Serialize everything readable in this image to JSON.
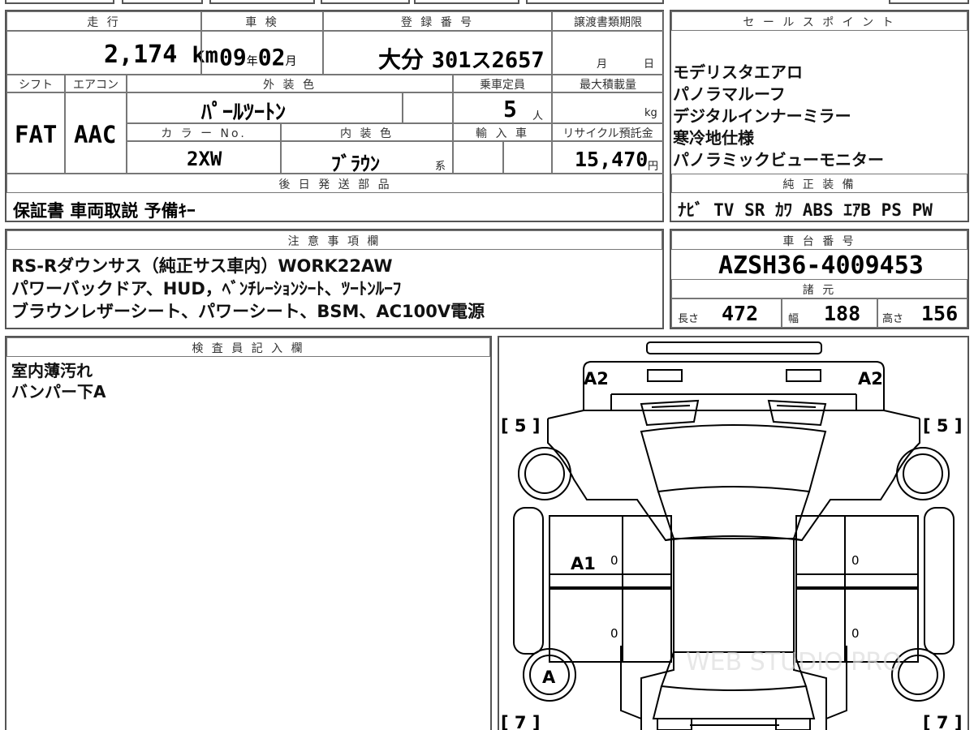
{
  "vehicle": {
    "mileage_label": "走 行",
    "mileage_value": "2,174",
    "mileage_unit": "km",
    "shaken_label": "車 検",
    "shaken_year": "09",
    "shaken_year_unit": "年",
    "shaken_month": "02",
    "shaken_month_unit": "月",
    "registration_label": "登 録 番 号",
    "registration_area": "大分",
    "registration_class": "301",
    "registration_kana": "ス",
    "registration_number": "2657",
    "transfer_label": "譲渡書類期限",
    "transfer_month": "月",
    "transfer_day": "日",
    "shift_label": "シフト",
    "shift_value": "FAT",
    "ac_label": "エアコン",
    "ac_value": "AAC",
    "exterior_color_label": "外 装 色",
    "exterior_color_value": "ﾊﾟｰﾙﾂｰﾄﾝ",
    "capacity_label": "乗車定員",
    "capacity_value": "5",
    "capacity_unit": "人",
    "max_load_label": "最大積載量",
    "max_load_unit": "kg",
    "color_no_label": "カ ラ ー No.",
    "color_no_value": "2XW",
    "interior_color_label": "内 装 色",
    "interior_color_value": "ﾌﾞﾗｳﾝ",
    "interior_color_suffix": "系",
    "import_label": "輸 入 車",
    "recycle_label": "リサイクル預託金",
    "recycle_value": "15,470",
    "recycle_unit": "円"
  },
  "sales_points": {
    "label": "セ ー ル ス ポ イ ン ト",
    "items": [
      "モデリスタエアロ",
      "パノラマルーフ",
      "デジタルインナーミラー",
      "寒冷地仕様",
      "パノラミックビューモニター"
    ]
  },
  "equipment": {
    "label": "純 正 装 備",
    "items": [
      "ﾅﾋﾞ",
      "TV",
      "SR",
      "ｶﾜ",
      "ABS",
      "ｴｱB",
      "PS",
      "PW"
    ]
  },
  "later_parts": {
    "label": "後 日 発 送 部 品",
    "value": "保証書 車両取説 予備ｷｰ"
  },
  "notes": {
    "label": "注 意 事 項 欄",
    "lines": [
      "RS-Rダウンサス（純正サス車内）WORK22AW",
      "パワーバックドア、HUD，ﾍﾞﾝﾁﾚｰｼｮﾝｼｰﾄ、ﾂｰﾄﾝﾙｰﾌ",
      "ブラウンレザーシート、パワーシート、BSM、AC100V電源"
    ]
  },
  "chassis": {
    "label": "車 台 番 号",
    "value": "AZSH36-4009453"
  },
  "specs": {
    "label": "諸 元",
    "length_label": "長さ",
    "length_value": "472",
    "width_label": "幅",
    "width_value": "188",
    "height_label": "高さ",
    "height_value": "156"
  },
  "inspector": {
    "label": "検 査 員 記 入 欄",
    "lines": [
      "室内薄汚れ",
      "バンパー下A"
    ]
  },
  "diagram": {
    "front_left_mark": "A2",
    "front_right_mark": "A2",
    "front_left_tire": "[ 5 ]",
    "front_right_tire": "[ 5 ]",
    "rear_left_tire": "[ 7 ]",
    "rear_right_tire": "[ 7 ]",
    "door_mark": "A1",
    "wheel_mark": "A",
    "zero_1": "0",
    "zero_2": "0",
    "zero_3": "0",
    "zero_4": "0",
    "watermark": "WEB STUDIO PRO"
  }
}
